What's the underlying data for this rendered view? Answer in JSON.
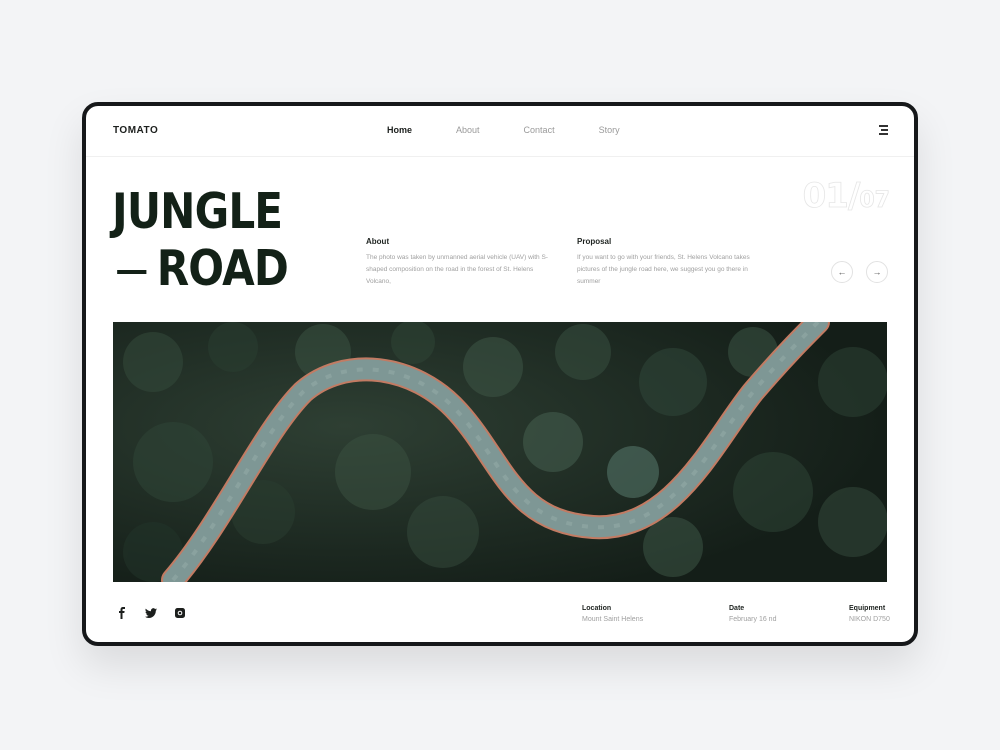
{
  "nav": {
    "logo": "TOMATO",
    "items": [
      {
        "label": "Home",
        "active": true
      },
      {
        "label": "About",
        "active": false
      },
      {
        "label": "Contact",
        "active": false
      },
      {
        "label": "Story",
        "active": false
      }
    ],
    "menu_icon": "hamburger-icon"
  },
  "hero": {
    "title_line1": "JUNGLE",
    "title_line2": "ROAD",
    "counter_current": "01/",
    "counter_total": "07",
    "prev_label": "←",
    "next_label": "→"
  },
  "about": {
    "heading": "About",
    "body": "The photo was taken by unmanned aerial vehicle (UAV) with S-shaped composition on the road in the forest of St. Helens Volcano,"
  },
  "proposal": {
    "heading": "Proposal",
    "body": "If you want to go with your friends, St. Helens Volcano takes pictures of the jungle road here, we suggest you go there in summer"
  },
  "image": {
    "alt": "Aerial photo of an S-shaped road through dense forest"
  },
  "social": [
    "facebook-icon",
    "twitter-icon",
    "instagram-icon"
  ],
  "meta": {
    "location_label": "Location",
    "location_value": "Mount Saint Helens",
    "date_label": "Date",
    "date_value": "February 16 nd",
    "equipment_label": "Equipment",
    "equipment_value": "NIKON D750"
  }
}
